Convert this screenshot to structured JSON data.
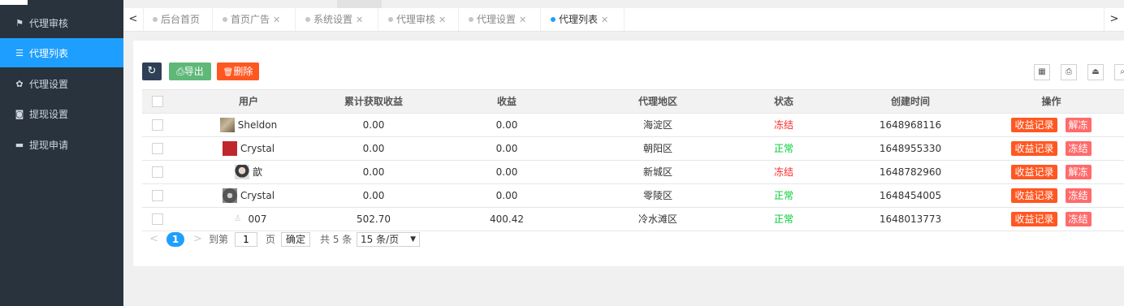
{
  "sidebar": {
    "items": [
      {
        "label": "代理审核",
        "icon": "flag-icon",
        "glyph": "⚑",
        "active": false
      },
      {
        "label": "代理列表",
        "icon": "list-icon",
        "glyph": "☰",
        "active": true
      },
      {
        "label": "代理设置",
        "icon": "gear-icon",
        "glyph": "✿",
        "active": false
      },
      {
        "label": "提现设置",
        "icon": "money-icon",
        "glyph": "◙",
        "active": false
      },
      {
        "label": "提现申请",
        "icon": "credit-card-icon",
        "glyph": "▬",
        "active": false
      }
    ]
  },
  "tabs": {
    "prev_glyph": "<",
    "next_glyph": ">",
    "items": [
      {
        "label": "后台首页",
        "closable": false,
        "active": false
      },
      {
        "label": "首页广告",
        "closable": true,
        "active": false
      },
      {
        "label": "系统设置",
        "closable": true,
        "active": false
      },
      {
        "label": "代理审核",
        "closable": true,
        "active": false
      },
      {
        "label": "代理设置",
        "closable": true,
        "active": false
      },
      {
        "label": "代理列表",
        "closable": true,
        "active": true
      }
    ],
    "close_glyph": "✕"
  },
  "toolbar": {
    "refresh_glyph": "↻",
    "export_label": "导出",
    "delete_label": "删除",
    "export_glyph": "⎙",
    "delete_glyph": "🗑"
  },
  "table_tools": [
    {
      "icon": "columns-icon",
      "glyph": "▦"
    },
    {
      "icon": "print-icon",
      "glyph": "⎙"
    },
    {
      "icon": "export-icon",
      "glyph": "⏏"
    },
    {
      "icon": "search-icon",
      "glyph": "⌕"
    }
  ],
  "table": {
    "headers": [
      "用户",
      "累计获取收益",
      "收益",
      "代理地区",
      "状态",
      "创建时间",
      "操作"
    ],
    "rows": [
      {
        "user": "Sheldon",
        "total": "0.00",
        "earn": "0.00",
        "area": "海淀区",
        "status": "冻结",
        "status_type": "frozen",
        "time": "1648968116",
        "op1": "收益记录",
        "op2": "解冻"
      },
      {
        "user": "Crystal",
        "total": "0.00",
        "earn": "0.00",
        "area": "朝阳区",
        "status": "正常",
        "status_type": "normal",
        "time": "1648955330",
        "op1": "收益记录",
        "op2": "冻结"
      },
      {
        "user": "歆",
        "total": "0.00",
        "earn": "0.00",
        "area": "新城区",
        "status": "冻结",
        "status_type": "frozen",
        "time": "1648782960",
        "op1": "收益记录",
        "op2": "解冻"
      },
      {
        "user": "Crystal",
        "total": "0.00",
        "earn": "0.00",
        "area": "零陵区",
        "status": "正常",
        "status_type": "normal",
        "time": "1648454005",
        "op1": "收益记录",
        "op2": "冻结"
      },
      {
        "user": "007",
        "total": "502.70",
        "earn": "400.42",
        "area": "冷水滩区",
        "status": "正常",
        "status_type": "normal",
        "time": "1648013773",
        "op1": "收益记录",
        "op2": "冻结"
      }
    ]
  },
  "pager": {
    "prev_glyph": "<",
    "next_glyph": ">",
    "current": "1",
    "goto_label": "到第",
    "goto_value": "1",
    "page_unit": "页",
    "confirm_label": "确定",
    "total_label": "共 5 条",
    "page_size": "15 条/页",
    "caret": "▼"
  },
  "colors": {
    "sidebar_bg": "#28333e",
    "active_blue": "#1e9fff",
    "export_green": "#5fb878",
    "delete_orange": "#ff5722",
    "status_frozen": "#ff2a2a",
    "status_normal": "#00cc33"
  }
}
